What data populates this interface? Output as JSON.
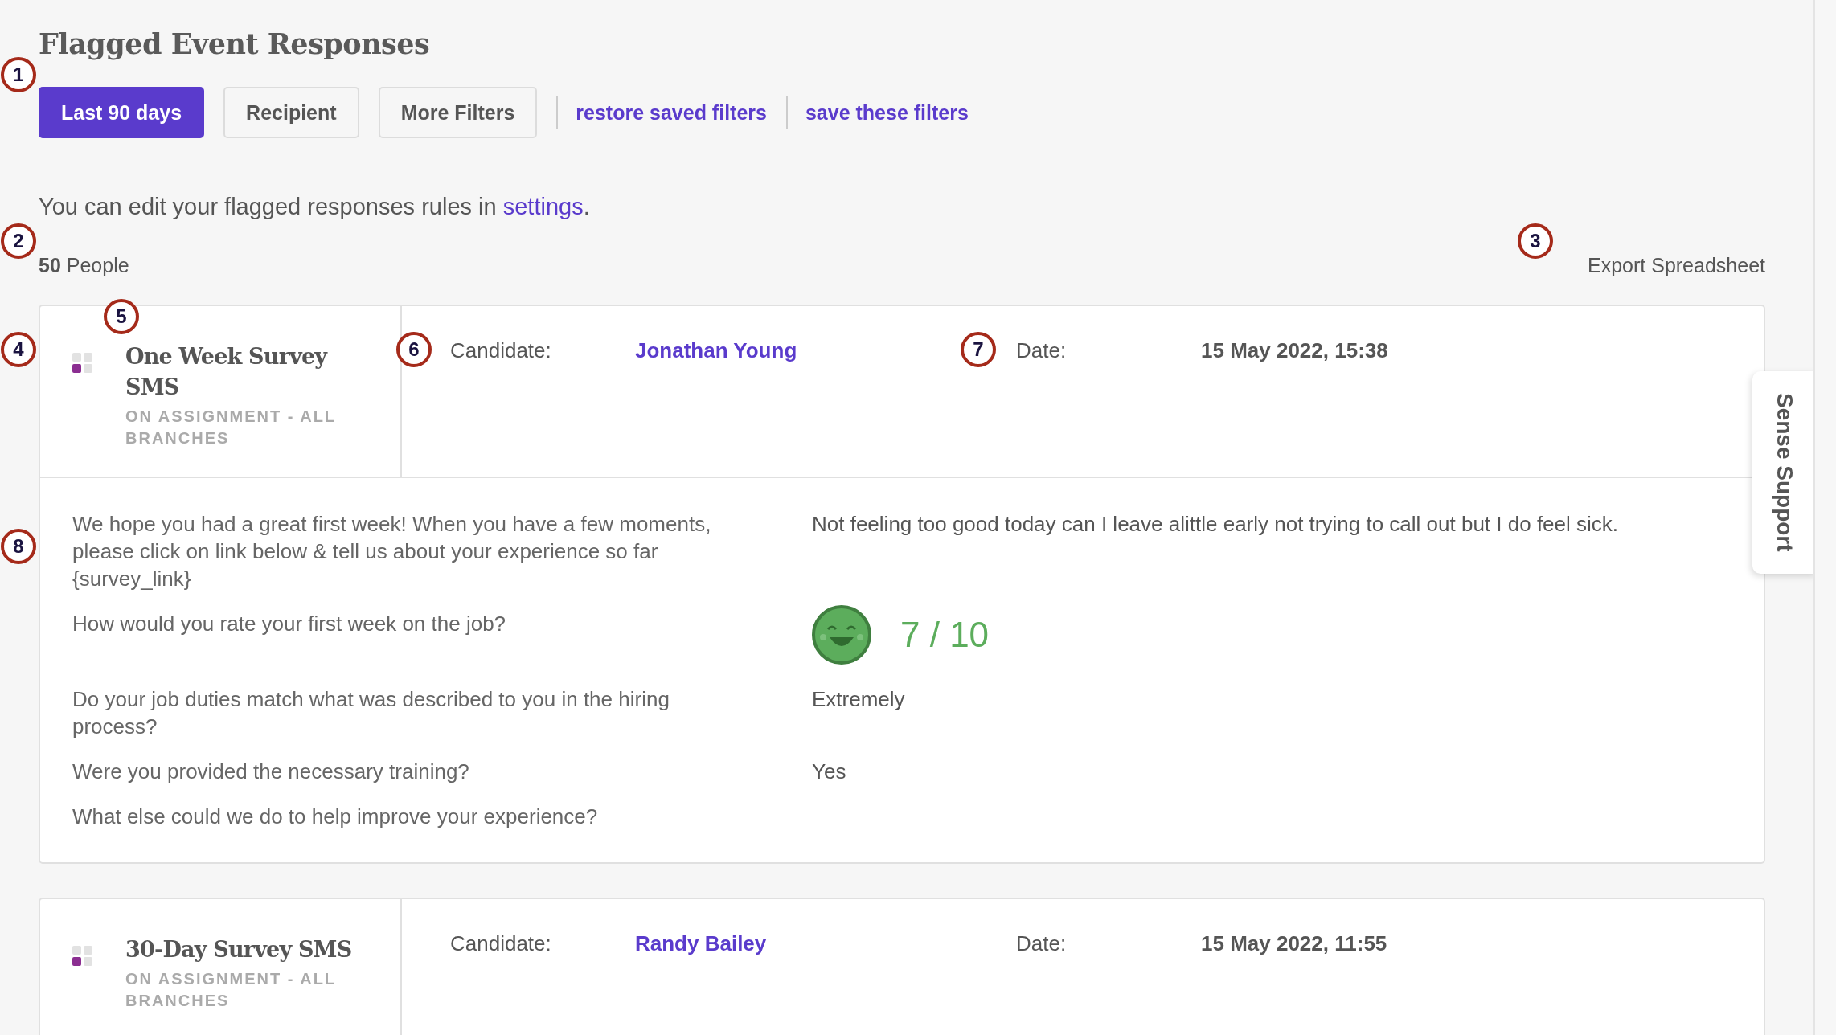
{
  "page": {
    "title": "Flagged Event Responses"
  },
  "filters": {
    "buttons": [
      {
        "label": "Last 90 days",
        "selected": true
      },
      {
        "label": "Recipient",
        "selected": false
      },
      {
        "label": "More Filters",
        "selected": false
      }
    ],
    "links": [
      "restore saved filters",
      "save these filters"
    ]
  },
  "notice": {
    "text": "You can edit your flagged responses rules in ",
    "link": "settings",
    "end": "."
  },
  "summary": {
    "count": "50",
    "unit": "People",
    "export": "Export Spreadsheet"
  },
  "responses": [
    {
      "survey": "One Week Survey SMS",
      "segment": "ON ASSIGNMENT - ALL BRANCHES",
      "candidate_label": "Candidate:",
      "candidate": "Jonathan Young",
      "date_label": "Date:",
      "date": "15 May 2022, 15:38",
      "qa": [
        {
          "question": "We hope you had a great first week! When you have a few moments, please click on link below & tell us about your experience so far {survey_link}",
          "kind": "text",
          "answer": "Not feeling too good today can I leave alittle early not trying to call out but I do feel sick."
        },
        {
          "question": "How would you rate your first week on the job?",
          "kind": "rating",
          "answer": "7 / 10"
        },
        {
          "question": "Do your job duties match what was described to you in the hiring process?",
          "kind": "text",
          "answer": "Extremely"
        },
        {
          "question": "Were you provided the necessary training?",
          "kind": "text",
          "answer": "Yes"
        },
        {
          "question": "What else could we do to help improve your experience?",
          "kind": "text"
        }
      ]
    },
    {
      "survey": "30-Day Survey SMS",
      "segment": "ON ASSIGNMENT - ALL BRANCHES",
      "candidate_label": "Candidate:",
      "candidate": "Randy Bailey",
      "date_label": "Date:",
      "date": "15 May 2022, 11:55"
    }
  ],
  "support_tab": "Sense Support",
  "callouts": [
    "1",
    "2",
    "3",
    "4",
    "5",
    "6",
    "7",
    "8"
  ]
}
